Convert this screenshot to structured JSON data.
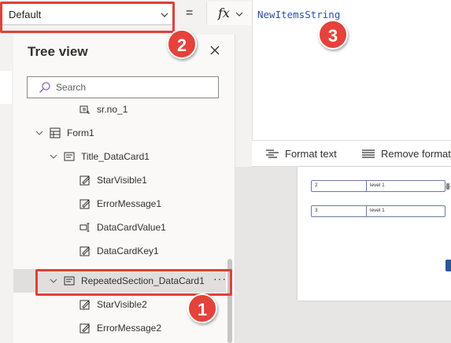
{
  "property_bar": {
    "selected_property": "Default",
    "equals_sign": "=",
    "fx_label": "fx"
  },
  "formula_bar": {
    "formula": "NewItemsString",
    "toolbar": {
      "format_text_label": "Format text",
      "remove_formatting_label": "Remove formatting"
    }
  },
  "tree_view": {
    "title": "Tree view",
    "search_placeholder": "Search",
    "items": [
      {
        "label": "sr.no_1",
        "icon": "label-icon",
        "level": 3,
        "expandable": false,
        "selected": false
      },
      {
        "label": "Form1",
        "icon": "form-icon",
        "level": 1,
        "expandable": true,
        "selected": false
      },
      {
        "label": "Title_DataCard1",
        "icon": "datacard-icon",
        "level": 2,
        "expandable": true,
        "selected": false
      },
      {
        "label": "StarVisible1",
        "icon": "edit-icon",
        "level": 3,
        "expandable": false,
        "selected": false
      },
      {
        "label": "ErrorMessage1",
        "icon": "edit-icon",
        "level": 3,
        "expandable": false,
        "selected": false
      },
      {
        "label": "DataCardValue1",
        "icon": "text-input-icon",
        "level": 3,
        "expandable": false,
        "selected": false
      },
      {
        "label": "DataCardKey1",
        "icon": "edit-icon",
        "level": 3,
        "expandable": false,
        "selected": false
      },
      {
        "label": "RepeatedSection_DataCard1",
        "icon": "datacard-icon",
        "level": 2,
        "expandable": true,
        "selected": true,
        "more_label": "···"
      },
      {
        "label": "StarVisible2",
        "icon": "edit-icon",
        "level": 3,
        "expandable": false,
        "selected": false
      },
      {
        "label": "ErrorMessage2",
        "icon": "edit-icon",
        "level": 3,
        "expandable": false,
        "selected": false
      }
    ]
  },
  "canvas": {
    "rows": [
      {
        "number": "2",
        "text": "level 1"
      },
      {
        "number": "3",
        "text": "level 1"
      }
    ]
  },
  "callouts": [
    {
      "number": "1",
      "target": "RepeatedSection_DataCard1"
    },
    {
      "number": "2",
      "target": "Default"
    },
    {
      "number": "3",
      "target": "NewItemsString"
    }
  ],
  "colors": {
    "callout": "#e0403a",
    "formula_text": "#2b4fa8",
    "selection": "#e1dfdd"
  }
}
